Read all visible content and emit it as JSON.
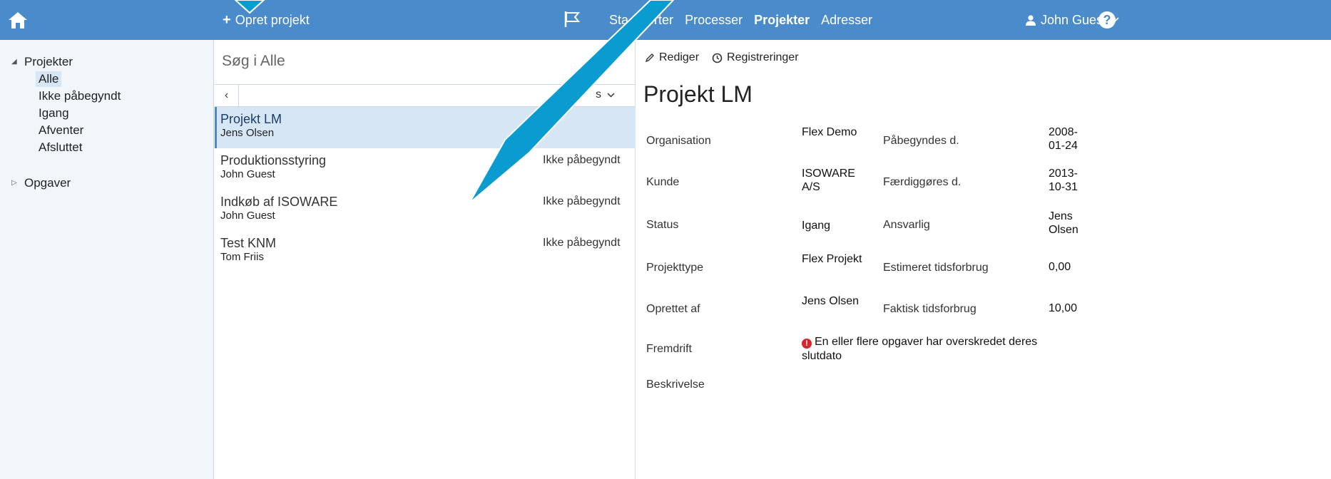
{
  "topbar": {
    "create_label": "Opret projekt",
    "nav": [
      "Sta",
      "porter",
      "Processer",
      "Projekter",
      "Adresser"
    ],
    "active_nav": "Projekter",
    "user": "John Guest",
    "help": "?"
  },
  "sidebar": {
    "groups": [
      {
        "label": "Projekter",
        "expanded": true,
        "children": [
          "Alle",
          "Ikke påbegyndt",
          "Igang",
          "Afventer",
          "Afsluttet"
        ],
        "selected": "Alle"
      },
      {
        "label": "Opgaver",
        "expanded": false
      }
    ]
  },
  "list": {
    "search_placeholder": "Søg i Alle",
    "prev_label": "‹",
    "status_filter": "s",
    "rows": [
      {
        "name": "Projekt LM",
        "responsible": "Jens Olsen",
        "status": "",
        "selected": true
      },
      {
        "name": "Produktionsstyring",
        "responsible": "John Guest",
        "status": "Ikke påbegyndt"
      },
      {
        "name": "Indkøb af ISOWARE",
        "responsible": "John Guest",
        "status": "Ikke påbegyndt"
      },
      {
        "name": "Test KNM",
        "responsible": "Tom Friis",
        "status": "Ikke påbegyndt"
      }
    ]
  },
  "detail": {
    "toolbar": {
      "edit": "Rediger",
      "registrations": "Registreringer"
    },
    "title": "Projekt LM",
    "fields_left": [
      {
        "label": "Organisation",
        "value": "Flex Demo"
      },
      {
        "label": "Kunde",
        "value": "ISOWARE A/S"
      },
      {
        "label": "Status",
        "value": "Igang"
      },
      {
        "label": "Projekttype",
        "value": "Flex Projekt"
      },
      {
        "label": "Oprettet af",
        "value": "Jens Olsen"
      }
    ],
    "fields_right": [
      {
        "label": "Påbegyndes d.",
        "value": "2008-01-24"
      },
      {
        "label": "Færdiggøres d.",
        "value": "2013-10-31"
      },
      {
        "label": "Ansvarlig",
        "value": "Jens Olsen"
      },
      {
        "label": "Estimeret tidsforbrug",
        "value": "0,00"
      },
      {
        "label": "Faktisk tidsforbrug",
        "value": "10,00"
      }
    ],
    "progress_label": "Fremdrift",
    "progress_warning": "En eller flere opgaver har overskredet deres slutdato",
    "description_label": "Beskrivelse"
  },
  "colors": {
    "topbar": "#4a8ccb",
    "selected_bg": "#d6e6f5",
    "sidebar_bg": "#f1f6fb",
    "warning": "#d9252b",
    "arrow": "#0a9bd0"
  }
}
